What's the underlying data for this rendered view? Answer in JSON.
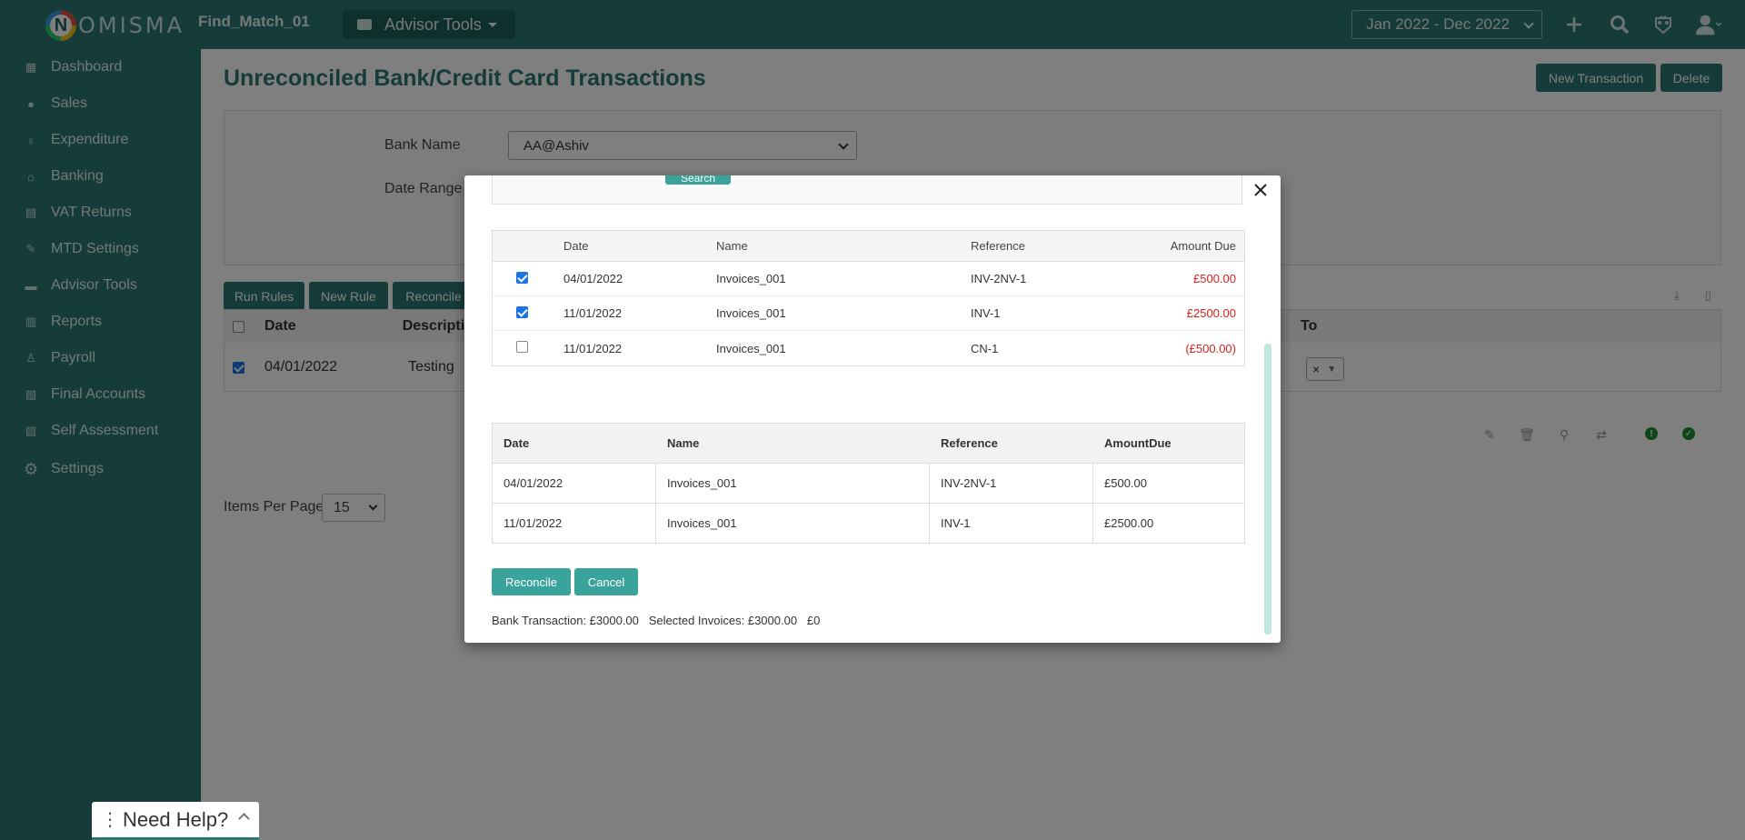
{
  "app": {
    "logo_letter": "N",
    "logo_text": "OMISMA",
    "company": "Find_Match_01"
  },
  "header": {
    "advisor_tools_label": "Advisor Tools",
    "date_range": "Jan 2022 - Dec 2022",
    "icons": [
      "plus-icon",
      "search-icon",
      "crest-icon",
      "user-icon"
    ]
  },
  "sidebar": {
    "items": [
      {
        "label": "Dashboard",
        "icon": "dashboard-icon"
      },
      {
        "label": "Sales",
        "icon": "sales-icon"
      },
      {
        "label": "Expenditure",
        "icon": "expenditure-icon"
      },
      {
        "label": "Banking",
        "icon": "bank-icon"
      },
      {
        "label": "VAT Returns",
        "icon": "vat-icon"
      },
      {
        "label": "MTD Settings",
        "icon": "mtd-icon"
      },
      {
        "label": "Advisor Tools",
        "icon": "briefcase-icon"
      },
      {
        "label": "Reports",
        "icon": "reports-icon"
      },
      {
        "label": "Payroll",
        "icon": "payroll-icon"
      },
      {
        "label": "Final Accounts",
        "icon": "final-accounts-icon"
      },
      {
        "label": "Self Assessment",
        "icon": "self-assessment-icon"
      },
      {
        "label": "Settings",
        "icon": "gear-icon"
      }
    ]
  },
  "page": {
    "title": "Unreconciled Bank/Credit Card Transactions",
    "new_transaction": "New Transaction",
    "delete": "Delete",
    "bank_name_label": "Bank Name",
    "bank_name_value": "AA@Ashiv",
    "date_range_label": "Date Range",
    "run_rules": "Run Rules",
    "new_rule": "New Rule",
    "reconcile": "Reconcile",
    "columns": {
      "date": "Date",
      "description": "Descripti",
      "to": "To"
    },
    "row": {
      "date": "04/01/2022",
      "description": "Testing",
      "to_clear": "×"
    },
    "items_per_page_label": "Items Per Page",
    "items_per_page_value": "15"
  },
  "modal": {
    "search_label": "Search",
    "invoice_columns": {
      "date": "Date",
      "name": "Name",
      "reference": "Reference",
      "amount": "Amount Due"
    },
    "invoices": [
      {
        "checked": true,
        "date": "04/01/2022",
        "name": "Invoices_001",
        "reference": "INV-2NV-1",
        "amount": "£500.00"
      },
      {
        "checked": true,
        "date": "11/01/2022",
        "name": "Invoices_001",
        "reference": "INV-1",
        "amount": "£2500.00"
      },
      {
        "checked": false,
        "date": "11/01/2022",
        "name": "Invoices_001",
        "reference": "CN-1",
        "amount": "(£500.00)"
      }
    ],
    "selected_columns": {
      "date": "Date",
      "name": "Name",
      "reference": "Reference",
      "amount": "AmountDue"
    },
    "selected": [
      {
        "date": "04/01/2022",
        "name": "Invoices_001",
        "reference": "INV-2NV-1",
        "amount": "£500.00"
      },
      {
        "date": "11/01/2022",
        "name": "Invoices_001",
        "reference": "INV-1",
        "amount": "£2500.00"
      }
    ],
    "reconcile_label": "Reconcile",
    "cancel_label": "Cancel",
    "summary": {
      "bank_transaction": "Bank Transaction: £3000.00",
      "selected_invoices": "Selected Invoices: £3000.00",
      "difference": "£0"
    }
  },
  "help": {
    "label": "Need Help?"
  },
  "colors": {
    "brand": "#2c7873",
    "accent": "#3aa39b",
    "negative": "#d9201c"
  }
}
